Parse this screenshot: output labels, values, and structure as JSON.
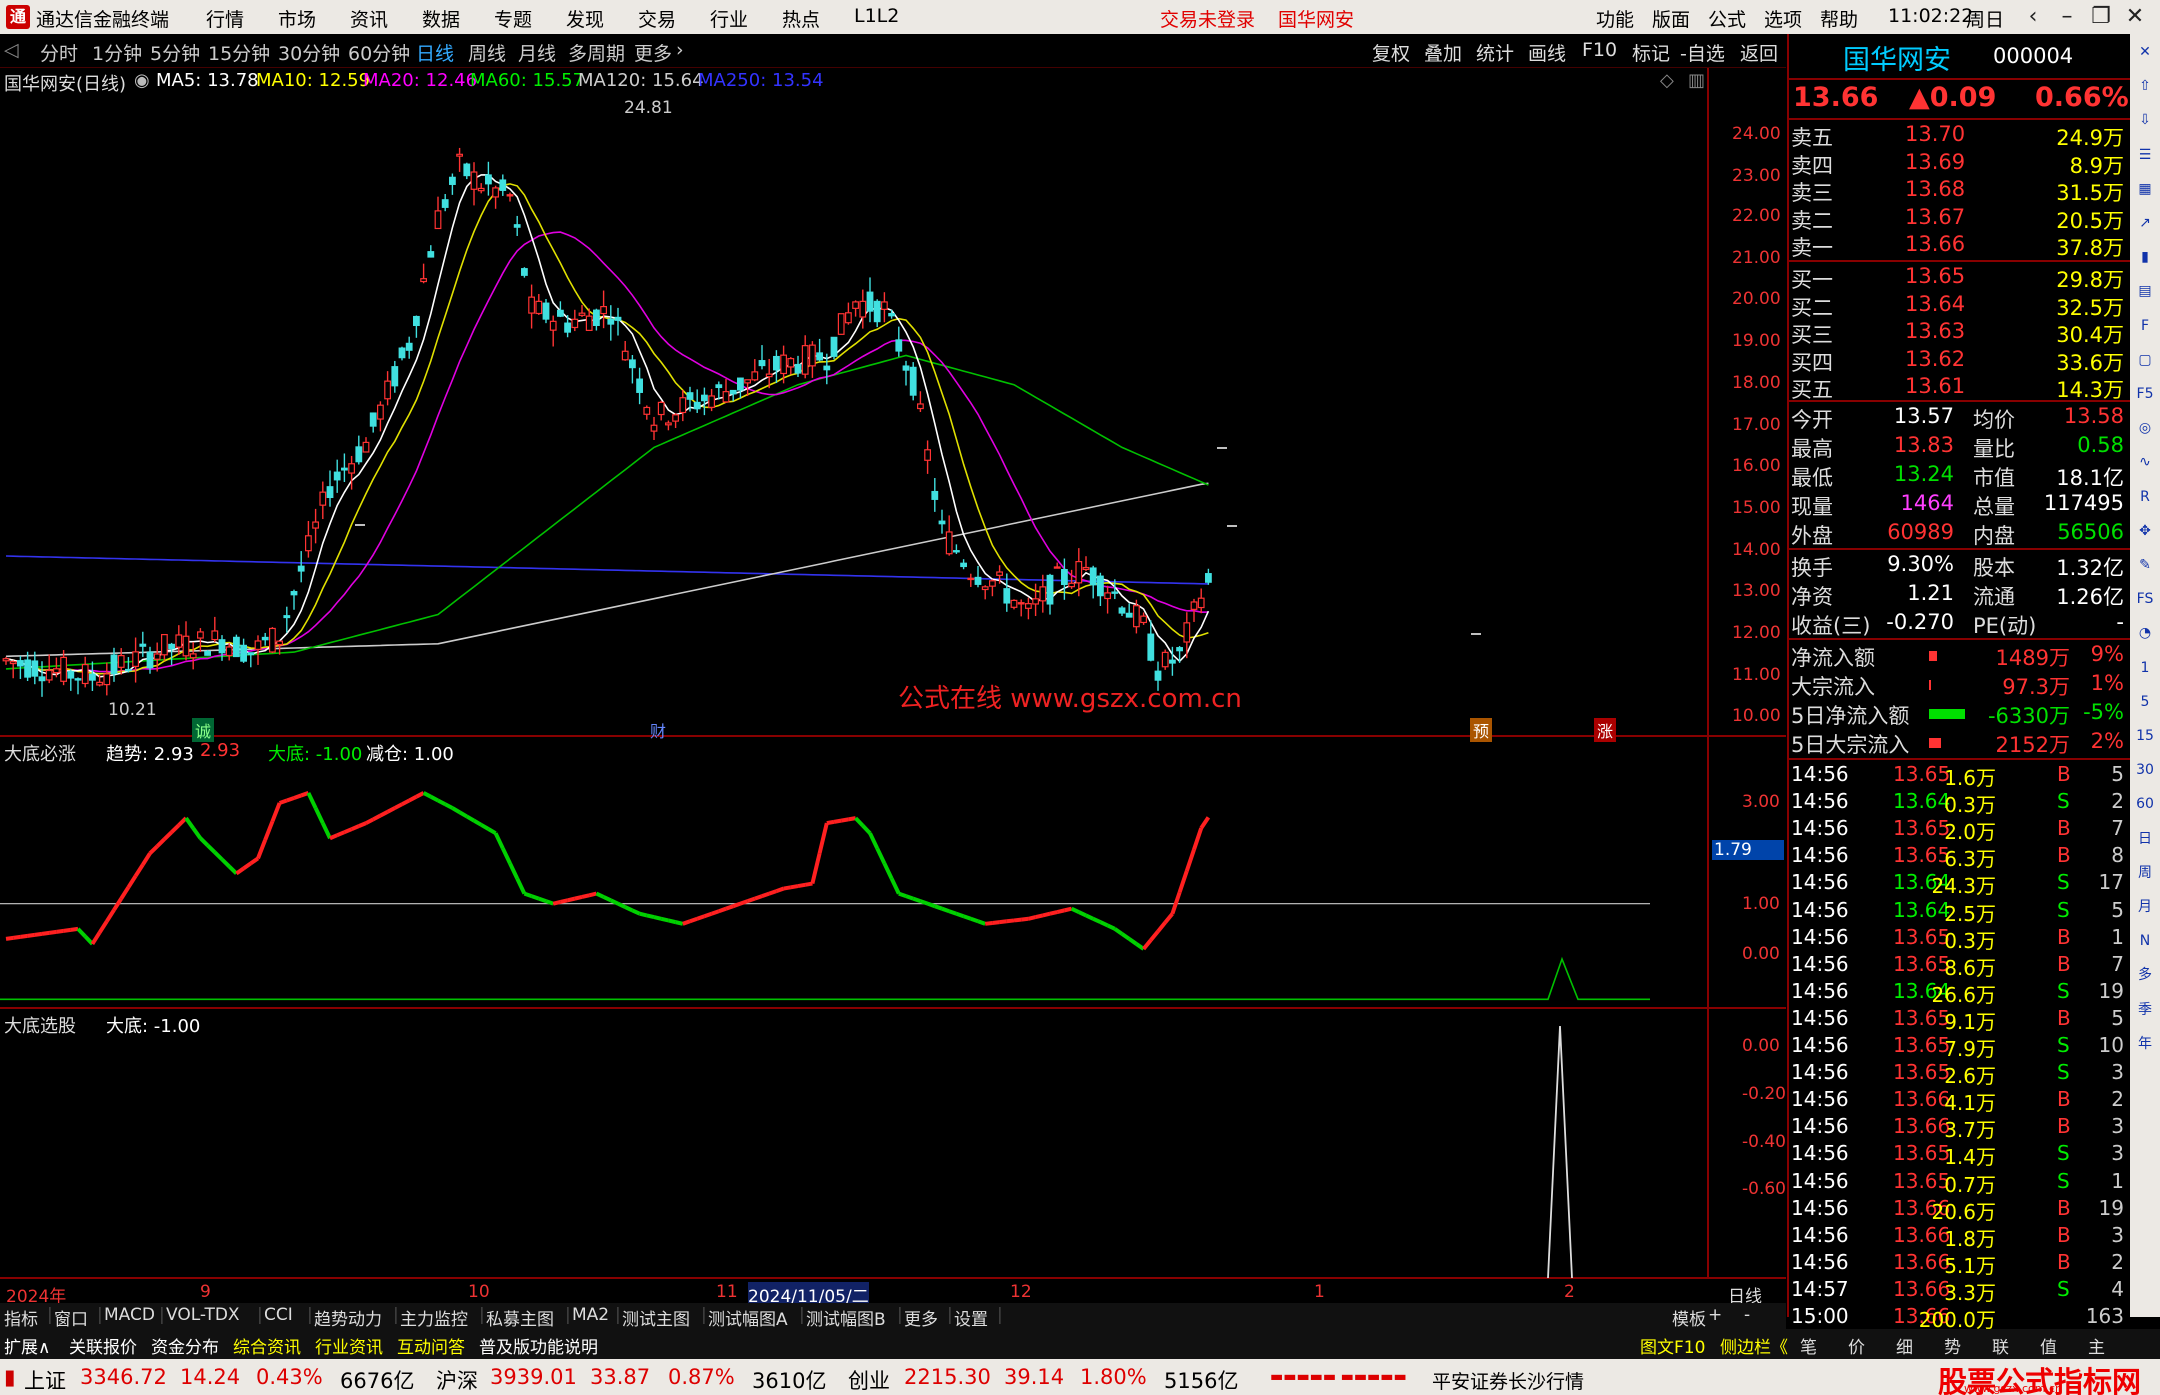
{
  "titlebar": {
    "app": "通达信金融终端",
    "menu": [
      "行情",
      "市场",
      "资讯",
      "数据",
      "专题",
      "发现",
      "交易",
      "行业",
      "热点",
      "L1L2"
    ],
    "trade_status": "交易未登录",
    "broker": "国华网安",
    "right_menu": [
      "功能",
      "版面",
      "公式",
      "选项",
      "帮助"
    ],
    "time": "11:02:22",
    "weekday": "周日"
  },
  "periods": [
    "分时",
    "1分钟",
    "5分钟",
    "15分钟",
    "30分钟",
    "60分钟",
    "日线",
    "周线",
    "月线",
    "多周期",
    "更多"
  ],
  "selected_period": "日线",
  "tools": [
    "复权",
    "叠加",
    "统计",
    "画线",
    "F10",
    "标记",
    "-自选",
    "返回"
  ],
  "main_legend": {
    "name": "国华网安(日线)",
    "ma5": "MA5: 13.78",
    "ma10": "MA10: 12.59",
    "ma20": "MA20: 12.46",
    "ma60": "MA60: 15.57",
    "ma120": "MA120: 15.64",
    "ma250": "MA250: 13.54"
  },
  "main_axis": [
    "24.00",
    "23.00",
    "22.00",
    "21.00",
    "20.00",
    "19.00",
    "18.00",
    "17.00",
    "16.00",
    "15.00",
    "14.00",
    "13.00",
    "12.00",
    "11.00",
    "10.00"
  ],
  "high_label": "24.81",
  "low_label": "10.21",
  "watermark": "公式在线 www.gszx.com.cn",
  "markers": [
    {
      "t": "诚",
      "c": "#2a2"
    },
    {
      "t": "财",
      "c": "#46f"
    },
    {
      "t": "预",
      "c": "#e80"
    },
    {
      "t": "涨",
      "c": "#e33"
    }
  ],
  "ind1_legend": {
    "name": "大底必涨",
    "trend": "趋势: 2.93",
    "v2": "2.93",
    "bottom": "大底: -1.00",
    "reduce": "减仓: 1.00"
  },
  "ind1_axis": [
    "3.00",
    "1.00",
    "0.00"
  ],
  "ind1_value": "1.79",
  "ind2_legend": {
    "name": "大底选股",
    "bottom": "大底: -1.00"
  },
  "ind2_axis": [
    "0.00",
    "-0.20",
    "-0.40",
    "-0.60"
  ],
  "date_axis": [
    "2024年",
    "9",
    "10",
    "11",
    "2024/11/05/二",
    "12",
    "1",
    "2"
  ],
  "date_right": "日线",
  "chart_data": {
    "type": "candlestick",
    "title": "国华网安(日线)",
    "ylim": [
      10,
      25
    ],
    "high": 24.81,
    "low": 10.21,
    "ma": {
      "MA5": 13.78,
      "MA10": 12.59,
      "MA20": 12.46,
      "MA60": 15.57,
      "MA120": 15.64,
      "MA250": 13.54
    }
  },
  "stock": {
    "name": "国华网安",
    "code": "000004",
    "price": "13.66",
    "change": "▲0.09",
    "pct": "0.66%"
  },
  "asks": [
    {
      "l": "卖五",
      "p": "13.70",
      "v": "24.9万"
    },
    {
      "l": "卖四",
      "p": "13.69",
      "v": "8.9万"
    },
    {
      "l": "卖三",
      "p": "13.68",
      "v": "31.5万"
    },
    {
      "l": "卖二",
      "p": "13.67",
      "v": "20.5万"
    },
    {
      "l": "卖一",
      "p": "13.66",
      "v": "37.8万"
    }
  ],
  "bids": [
    {
      "l": "买一",
      "p": "13.65",
      "v": "29.8万"
    },
    {
      "l": "买二",
      "p": "13.64",
      "v": "32.5万"
    },
    {
      "l": "买三",
      "p": "13.63",
      "v": "30.4万"
    },
    {
      "l": "买四",
      "p": "13.62",
      "v": "33.6万"
    },
    {
      "l": "买五",
      "p": "13.61",
      "v": "14.3万"
    }
  ],
  "stats": [
    {
      "a": "今开",
      "av": "13.57",
      "ac": "white",
      "b": "均价",
      "bv": "13.58",
      "bc": "red"
    },
    {
      "a": "最高",
      "av": "13.83",
      "ac": "red",
      "b": "量比",
      "bv": "0.58",
      "bc": "green"
    },
    {
      "a": "最低",
      "av": "13.24",
      "ac": "green",
      "b": "市值",
      "bv": "18.1亿",
      "bc": "white"
    },
    {
      "a": "现量",
      "av": "1464",
      "ac": "mag",
      "b": "总量",
      "bv": "117495",
      "bc": "white"
    },
    {
      "a": "外盘",
      "av": "60989",
      "ac": "red",
      "b": "内盘",
      "bv": "56506",
      "bc": "green"
    }
  ],
  "stats2": [
    {
      "a": "换手",
      "av": "9.30%",
      "b": "股本",
      "bv": "1.32亿"
    },
    {
      "a": "净资",
      "av": "1.21",
      "b": "流通",
      "bv": "1.26亿"
    },
    {
      "a": "收益(三)",
      "av": "-0.270",
      "b": "PE(动)",
      "bv": "-"
    }
  ],
  "flows": [
    {
      "l": "净流入额",
      "v": "1489万",
      "p": "9%",
      "c": "red"
    },
    {
      "l": "大宗流入",
      "v": "97.3万",
      "p": "1%",
      "c": "red"
    },
    {
      "l": "5日净流入额",
      "v": "-6330万",
      "p": "-5%",
      "c": "green"
    },
    {
      "l": "5日大宗流入",
      "v": "2152万",
      "p": "2%",
      "c": "red"
    }
  ],
  "ticks": [
    [
      "14:56",
      "13.65",
      "1.6万",
      "B",
      "5"
    ],
    [
      "14:56",
      "13.64",
      "0.3万",
      "S",
      "2"
    ],
    [
      "14:56",
      "13.65",
      "2.0万",
      "B",
      "7"
    ],
    [
      "14:56",
      "13.65",
      "6.3万",
      "B",
      "8"
    ],
    [
      "14:56",
      "13.64",
      "24.3万",
      "S",
      "17"
    ],
    [
      "14:56",
      "13.64",
      "2.5万",
      "S",
      "5"
    ],
    [
      "14:56",
      "13.65",
      "0.3万",
      "B",
      "1"
    ],
    [
      "14:56",
      "13.65",
      "8.6万",
      "B",
      "7"
    ],
    [
      "14:56",
      "13.64",
      "26.6万",
      "S",
      "19"
    ],
    [
      "14:56",
      "13.65",
      "9.1万",
      "B",
      "5"
    ],
    [
      "14:56",
      "13.65",
      "7.9万",
      "S",
      "10"
    ],
    [
      "14:56",
      "13.65",
      "2.6万",
      "S",
      "3"
    ],
    [
      "14:56",
      "13.66",
      "4.1万",
      "B",
      "2"
    ],
    [
      "14:56",
      "13.66",
      "3.7万",
      "B",
      "3"
    ],
    [
      "14:56",
      "13.65",
      "1.4万",
      "S",
      "3"
    ],
    [
      "14:56",
      "13.65",
      "0.7万",
      "S",
      "1"
    ],
    [
      "14:56",
      "13.66",
      "20.6万",
      "B",
      "19"
    ],
    [
      "14:56",
      "13.66",
      "1.8万",
      "B",
      "3"
    ],
    [
      "14:56",
      "13.66",
      "5.1万",
      "B",
      "2"
    ],
    [
      "14:57",
      "13.66",
      "3.3万",
      "S",
      "4"
    ],
    [
      "15:00",
      "13.66",
      "200.0万",
      "",
      "163"
    ]
  ],
  "tabs1": [
    "指标",
    "窗口",
    "MACD",
    "VOL-TDX",
    "CCI",
    "趋势动力",
    "主力监控",
    "私募主图",
    "MA2",
    "测试主图",
    "测试幅图A",
    "测试幅图B",
    "更多",
    "设置"
  ],
  "tabs1_right": [
    "模板",
    "+",
    "-"
  ],
  "tabs2": [
    "扩展∧",
    "关联报价",
    "资金分布",
    "综合资讯",
    "行业资讯",
    "互动问答",
    "普及版功能说明"
  ],
  "tabs2_right": [
    "图文F10",
    "侧边栏《",
    "笔",
    "价",
    "细",
    "势",
    "联",
    "值",
    "主"
  ],
  "status": {
    "sh_name": "上证",
    "sh": "3346.72",
    "sh_ch": "14.24",
    "sh_pct": "0.43%",
    "sh_amt": "6676亿",
    "sz_name": "沪深",
    "sz": "3939.01",
    "sz_ch": "33.87",
    "sz_pct": "0.87%",
    "sz_amt": "3610亿",
    "cy_name": "创业",
    "cy": "2215.30",
    "cy_ch": "39.14",
    "cy_pct": "1.80%",
    "cy_amt": "5156亿",
    "feed": "平安证券长沙行情",
    "brand": "股票公式指标网",
    "brand_url": "www.gszx.com.cn"
  },
  "side_icons": [
    "close-icon",
    "up-icon",
    "down-icon",
    "list-icon",
    "grid-icon",
    "chart-icon",
    "candle-icon",
    "table-icon",
    "f10-icon",
    "doc-icon",
    "f5-icon",
    "circle-icon",
    "wave-icon",
    "rsi-icon",
    "move-icon",
    "pen-icon",
    "fs-icon",
    "pie-icon",
    "1",
    "5",
    "15",
    "30",
    "60",
    "日",
    "周",
    "月",
    "N",
    "多",
    "季",
    "年"
  ]
}
